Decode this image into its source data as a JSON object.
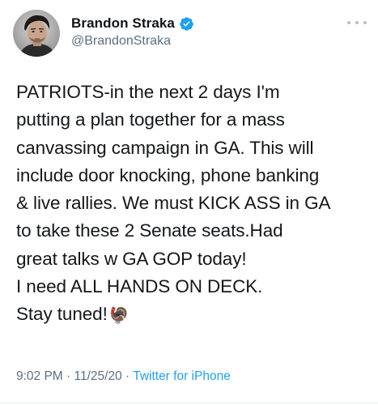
{
  "author": {
    "display_name": "Brandon Straka",
    "handle": "@BrandonStraka",
    "avatar_icon": "profile-photo",
    "verified_icon": "verified-badge-icon",
    "verified_color": "#1da1f2"
  },
  "more_icon": "more-horizontal-icon",
  "tweet": {
    "lines": [
      "PATRIOTS-in the next 2 days I'm",
      "putting a plan together for a mass",
      "canvassing campaign in GA. This will",
      "include door knocking, phone banking",
      "& live rallies. We must KICK ASS in GA",
      "to take these 2 Senate seats.Had",
      "great talks w GA GOP today!",
      "I need ALL HANDS ON DECK.",
      "Stay tuned!"
    ],
    "emoji": "🦃"
  },
  "meta": {
    "time": "9:02 PM",
    "separator": " · ",
    "date": "11/25/20",
    "source": "Twitter for iPhone",
    "source_color": "#1da1f2"
  }
}
